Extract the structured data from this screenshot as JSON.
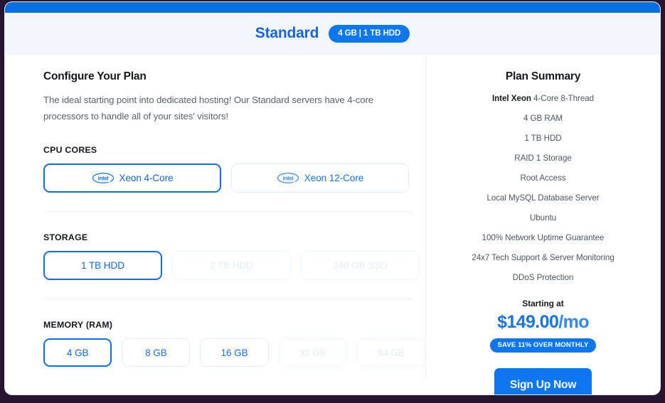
{
  "header": {
    "plan_name": "Standard",
    "badge": "4 GB | 1 TB HDD"
  },
  "configure": {
    "title": "Configure Your Plan",
    "description": "The ideal starting point into dedicated hosting! Our Standard servers have 4-core processors to handle all of your sites' visitors!",
    "sections": [
      {
        "label": "CPU CORES",
        "options": [
          {
            "label": "Xeon 4-Core",
            "icon": "intel-logo",
            "state": "selected"
          },
          {
            "label": "Xeon 12-Core",
            "icon": "intel-logo",
            "state": "available"
          }
        ]
      },
      {
        "label": "STORAGE",
        "options": [
          {
            "label": "1 TB HDD",
            "state": "selected"
          },
          {
            "label": "2 TB HDD",
            "state": "disabled"
          },
          {
            "label": "240 GB SSD",
            "state": "disabled"
          }
        ]
      },
      {
        "label": "MEMORY (RAM)",
        "options": [
          {
            "label": "4 GB",
            "state": "selected"
          },
          {
            "label": "8 GB",
            "state": "available"
          },
          {
            "label": "16 GB",
            "state": "available"
          },
          {
            "label": "32 GB",
            "state": "disabled"
          },
          {
            "label": "64 GB",
            "state": "disabled"
          }
        ]
      }
    ]
  },
  "summary": {
    "title": "Plan Summary",
    "cpu_bold": "Intel Xeon",
    "cpu_rest": " 4-Core 8-Thread",
    "specs": [
      "4 GB RAM",
      "1 TB HDD",
      "RAID 1 Storage",
      "Root Access",
      "Local MySQL Database Server",
      "Ubuntu",
      "100% Network Uptime Guarantee",
      "24x7 Tech Support & Server Monitoring",
      "DDoS Protection"
    ],
    "starting_at": "Starting at",
    "price": "$149.00",
    "price_period": "/mo",
    "save_badge": "SAVE 11% OVER MONTHLY",
    "cta": "Sign Up Now"
  },
  "colors": {
    "accent": "#0d77f2",
    "title_blue": "#1665e3",
    "header_band": "#f2f6fd",
    "page_bg": "#251530"
  }
}
